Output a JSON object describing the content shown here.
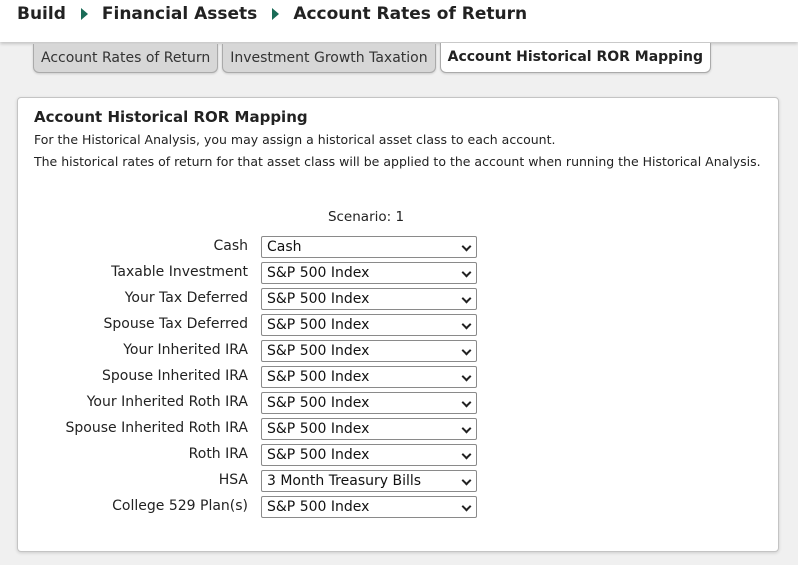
{
  "breadcrumb": [
    "Build",
    "Financial Assets",
    "Account Rates of Return"
  ],
  "tabs": [
    {
      "label": "Account Rates of Return",
      "active": false
    },
    {
      "label": "Investment Growth Taxation",
      "active": false
    },
    {
      "label": "Account Historical ROR Mapping",
      "active": true
    }
  ],
  "panel": {
    "title": "Account Historical ROR Mapping",
    "description_1": "For the Historical Analysis, you may assign a historical asset class to each account.",
    "description_2": "The historical rates of return for that asset class will be applied to the account when running the Historical Analysis.",
    "scenario_label": "Scenario: 1"
  },
  "rows": [
    {
      "label": "Cash",
      "value": "Cash"
    },
    {
      "label": "Taxable Investment",
      "value": "S&P 500 Index"
    },
    {
      "label": "Your Tax Deferred",
      "value": "S&P 500 Index"
    },
    {
      "label": "Spouse Tax Deferred",
      "value": "S&P 500 Index"
    },
    {
      "label": "Your Inherited IRA",
      "value": "S&P 500 Index"
    },
    {
      "label": "Spouse Inherited IRA",
      "value": "S&P 500 Index"
    },
    {
      "label": "Your Inherited Roth IRA",
      "value": "S&P 500 Index"
    },
    {
      "label": "Spouse Inherited Roth IRA",
      "value": "S&P 500 Index"
    },
    {
      "label": "Roth IRA",
      "value": "S&P 500 Index"
    },
    {
      "label": "HSA",
      "value": "3 Month Treasury Bills"
    },
    {
      "label": "College 529 Plan(s)",
      "value": "S&P 500 Index"
    }
  ],
  "colors": {
    "accent": "#1a6b57",
    "tab_inactive": "#d7d7d7",
    "background": "#f0f0f0"
  }
}
